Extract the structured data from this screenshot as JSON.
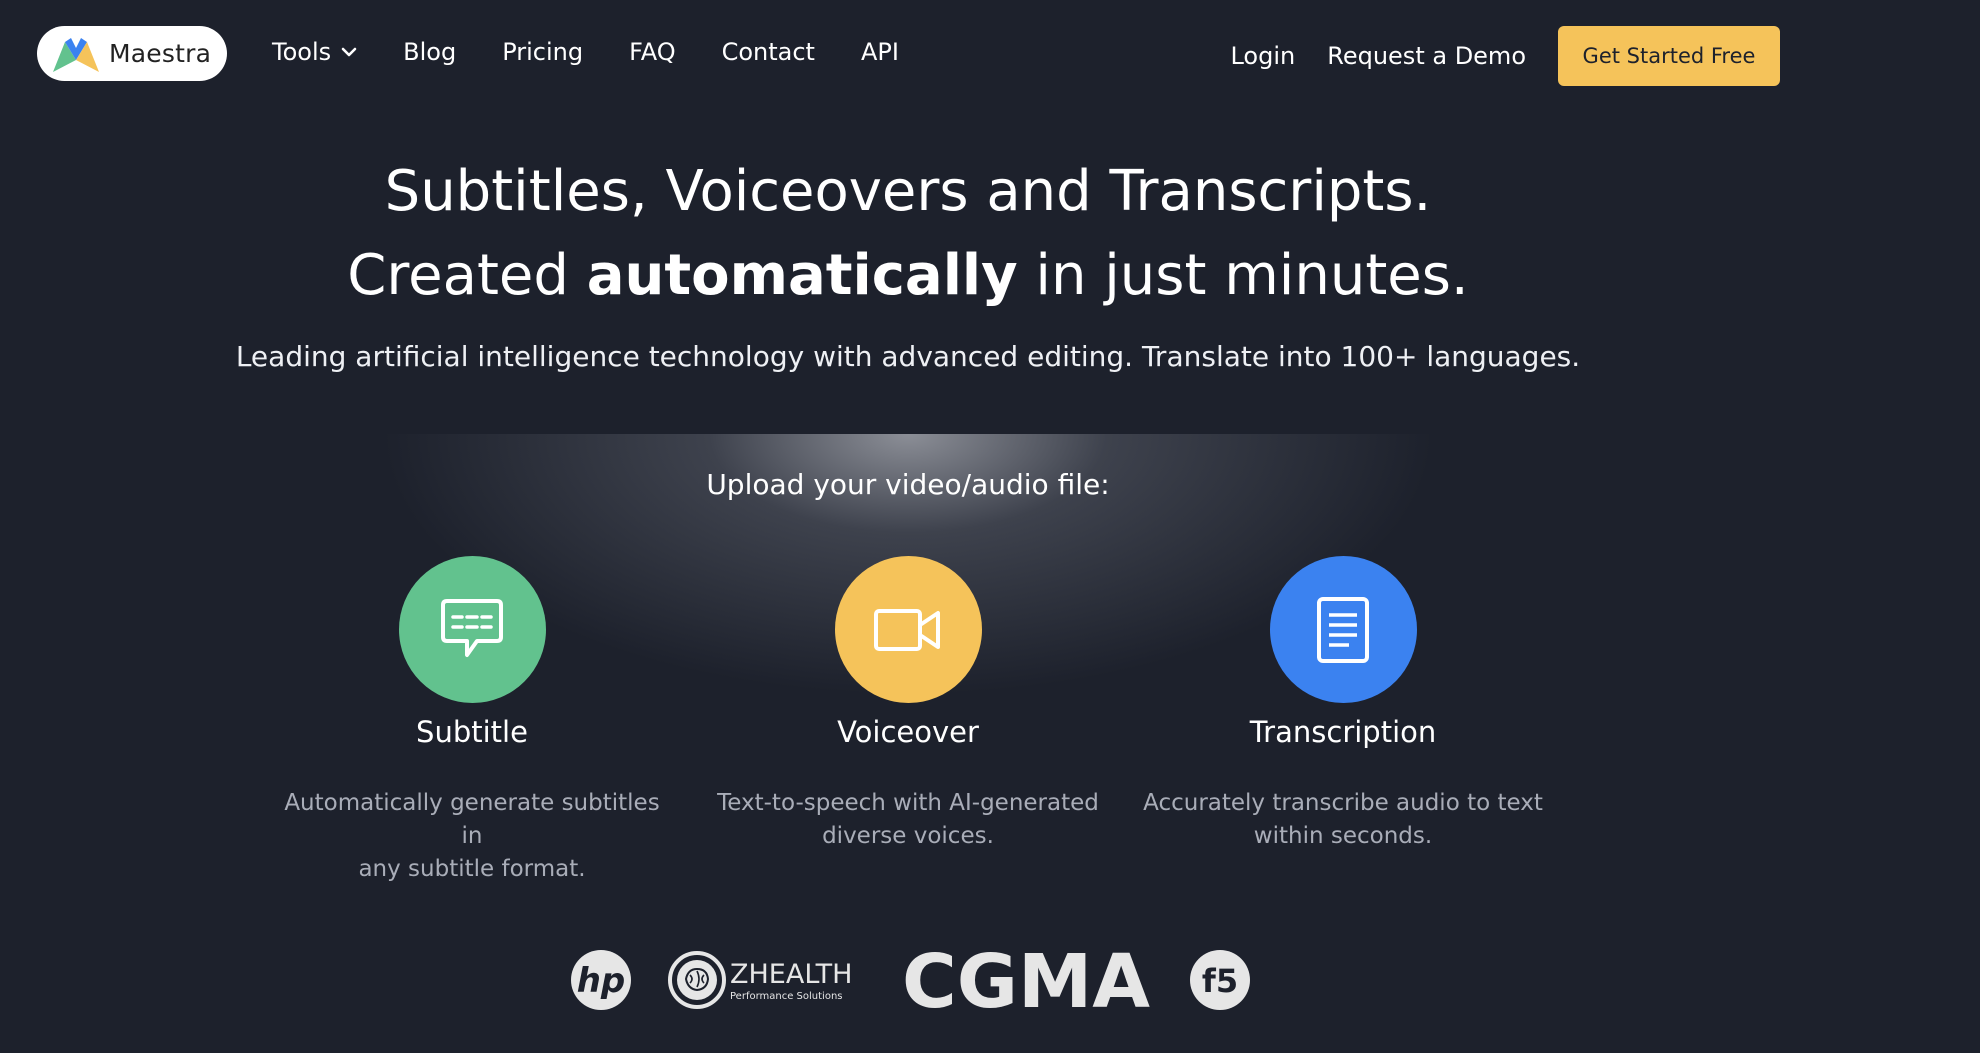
{
  "brand": {
    "name": "Maestra"
  },
  "nav": {
    "items": [
      {
        "label": "Tools",
        "has_dropdown": true
      },
      {
        "label": "Blog"
      },
      {
        "label": "Pricing"
      },
      {
        "label": "FAQ"
      },
      {
        "label": "Contact"
      },
      {
        "label": "API"
      }
    ],
    "login": "Login",
    "demo": "Request a Demo",
    "cta": "Get Started Free"
  },
  "hero": {
    "line1": "Subtitles, Voiceovers and Transcripts.",
    "line2_pre": "Created ",
    "line2_bold": "automatically",
    "line2_post": " in just minutes.",
    "subtitle": "Leading artificial intelligence technology with advanced editing. Translate into 100+ languages."
  },
  "upload": {
    "label": "Upload your video/audio file:",
    "options": [
      {
        "title": "Subtitle",
        "line1": "Automatically generate subtitles in",
        "line2": "any subtitle format.",
        "icon": "speech-bubble-icon",
        "color": "#62c28e"
      },
      {
        "title": "Voiceover",
        "line1": "Text-to-speech with AI-generated",
        "line2": "diverse voices.",
        "icon": "video-camera-icon",
        "color": "#f5c35a"
      },
      {
        "title": "Transcription",
        "line1": "Accurately transcribe audio to text",
        "line2": "within seconds.",
        "icon": "document-icon",
        "color": "#3b82f0"
      }
    ]
  },
  "clients": {
    "zhealth_main": "ZHEALTH",
    "zhealth_sub": "Performance Solutions",
    "cgma": "CGMA",
    "f5": "f5",
    "hp": "hp"
  },
  "colors": {
    "background": "#1d212c",
    "cta": "#f5c35a",
    "green": "#62c28e",
    "yellow": "#f5c35a",
    "blue": "#3b82f0"
  }
}
